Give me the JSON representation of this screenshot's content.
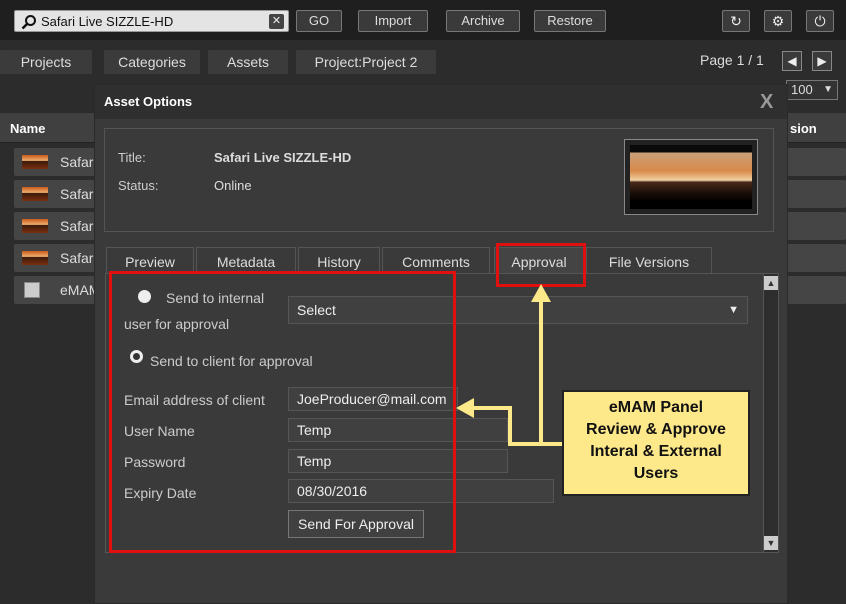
{
  "toolbar": {
    "search_value": "Safari Live SIZZLE-HD",
    "clear_label": "✕",
    "go_label": "GO",
    "import_label": "Import",
    "archive_label": "Archive",
    "restore_label": "Restore",
    "refresh_icon": "↻",
    "settings_icon": "⚙",
    "power_icon": "⏻"
  },
  "main_tabs": [
    "Projects",
    "Categories",
    "Assets",
    "Project:Project 2"
  ],
  "pagination": {
    "label": "Page 1 / 1",
    "prev": "◀",
    "next": "▶"
  },
  "page_size": "100",
  "list": {
    "header_name": "Name",
    "header_version": "sion",
    "rows": [
      "Safari",
      "Safari",
      "Safari",
      "Safari",
      "eMAM"
    ]
  },
  "modal": {
    "title": "Asset Options",
    "close_label": "X",
    "title_label": "Title:",
    "title_value": "Safari Live SIZZLE-HD",
    "status_label": "Status:",
    "status_value": "Online",
    "tabs": [
      "Preview",
      "Metadata",
      "History",
      "Comments",
      "Approval",
      "File Versions"
    ],
    "active_tab": "Approval",
    "approval": {
      "internal_label_line1": "Send to internal",
      "internal_label_line2": "user for approval",
      "select_value": "Select",
      "client_label": "Send to client for approval",
      "email_label": "Email address of client",
      "email_value": "JoeProducer@mail.com",
      "username_label": "User Name",
      "username_value": "Temp",
      "password_label": "Password",
      "password_value": "Temp",
      "expiry_label": "Expiry Date",
      "expiry_value": "08/30/2016",
      "send_button": "Send For Approval"
    }
  },
  "callout": {
    "line1": "eMAM Panel",
    "line2": "Review & Approve",
    "line3": "Interal & External",
    "line4": "Users"
  },
  "colors": {
    "annotation_red": "#e01010",
    "callout_yellow": "#fde88a"
  }
}
